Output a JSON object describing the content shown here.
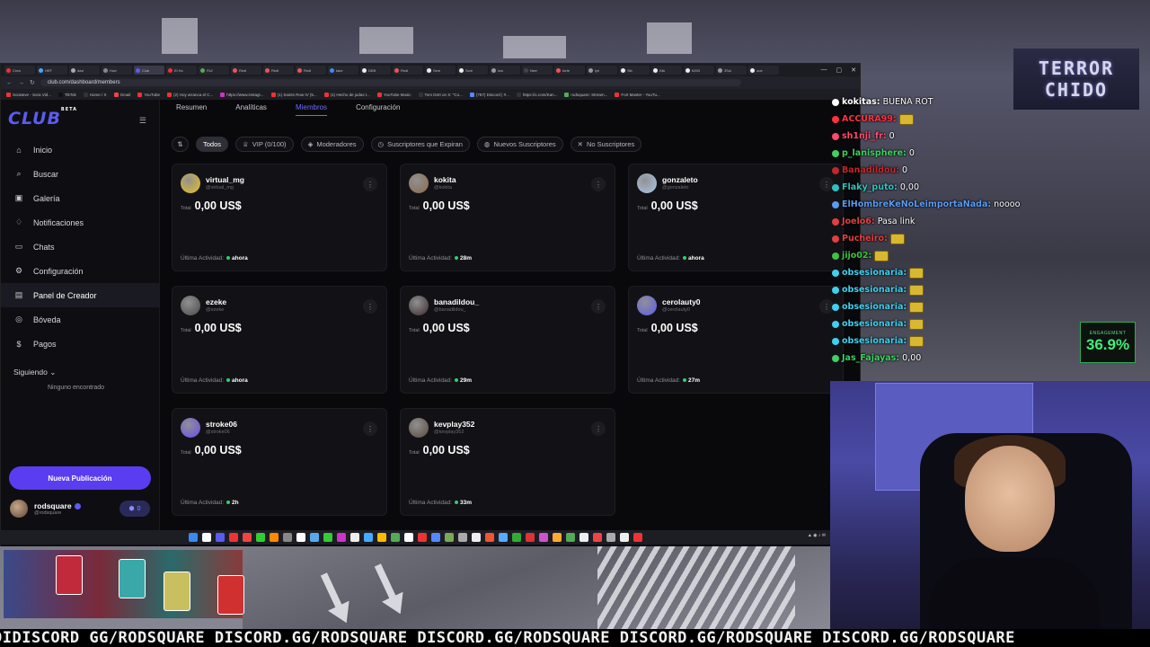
{
  "browser": {
    "url": "club.com/dashboard/members",
    "tabs": [
      "Crea",
      "HEF",
      "davi",
      "Hom",
      "Club",
      "El Ho",
      "Fk2",
      "Redi",
      "Redi",
      "Redi",
      "take",
      "DEB",
      "Redi",
      "Sem",
      "Scre",
      "low",
      "Nem",
      "forte",
      "lyri",
      "Sib",
      "Kiki",
      "6393",
      "3Sol",
      "ooe"
    ],
    "bookmarks": [
      "Sorateve - Sora Vid...",
      "TikTok",
      "Home / X",
      "Gmail",
      "YouTube",
      "(2) Hoy arranca el C...",
      "https://www.instagr...",
      "(1) Saints Row IV (5...",
      "(1) Hecho de judas t...",
      "YouTube Music",
      "Tom Dört on X: \"Co...",
      "(787) Discord | #...",
      "https://x.com/Kan...",
      "rodsquare: Stream...",
      "Fort Master - YouTu..."
    ]
  },
  "sidebar": {
    "logo": "CLUB",
    "logo_sup": "BETA",
    "items": [
      {
        "label": "Inicio",
        "icon": "home-icon"
      },
      {
        "label": "Buscar",
        "icon": "search-icon"
      },
      {
        "label": "Galería",
        "icon": "gallery-icon"
      },
      {
        "label": "Notificaciones",
        "icon": "bell-icon"
      },
      {
        "label": "Chats",
        "icon": "chat-icon"
      },
      {
        "label": "Configuración",
        "icon": "gear-icon"
      },
      {
        "label": "Panel de Creador",
        "icon": "dashboard-icon"
      },
      {
        "label": "Bóveda",
        "icon": "vault-icon"
      },
      {
        "label": "Pagos",
        "icon": "dollar-icon"
      }
    ],
    "active_index": 6,
    "following_label": "Siguiendo",
    "following_empty": "Ninguno encontrado",
    "new_post": "Nueva Publicación",
    "profile": {
      "name": "rodsquare",
      "handle": "@rodsquare",
      "badge": "0"
    }
  },
  "main": {
    "tabs": [
      "Resumen",
      "Analíticas",
      "Miembros",
      "Configuración"
    ],
    "active_tab": 2,
    "filters": [
      "Todos",
      "VIP (0/100)",
      "Moderadores",
      "Suscriptores que Expiran",
      "Nuevos Suscriptores",
      "No Suscriptores"
    ],
    "total_label": "Total",
    "activity_label": "Última Actividad:",
    "members": [
      {
        "name": "virtual_mg",
        "handle": "@virtual_mg",
        "total": "0,00 US$",
        "activity": "ahora",
        "color": "#e8c020"
      },
      {
        "name": "kokita",
        "handle": "@kokita",
        "total": "0,00 US$",
        "activity": "28m",
        "color": "#8a6a4a"
      },
      {
        "name": "gonzaleto",
        "handle": "@gonzaleto",
        "total": "0,00 US$",
        "activity": "ahora",
        "color": "#a8c8e8"
      },
      {
        "name": "ezeke",
        "handle": "@ezeke",
        "total": "0,00 US$",
        "activity": "ahora",
        "color": "#4a4a4a"
      },
      {
        "name": "banadildou_",
        "handle": "@banadildou_",
        "total": "0,00 US$",
        "activity": "29m",
        "color": "#3a2a2a"
      },
      {
        "name": "cerolauty0",
        "handle": "@cerolauty0",
        "total": "0,00 US$",
        "activity": "27m",
        "color": "#5a5cf0"
      },
      {
        "name": "stroke06",
        "handle": "@stroke06",
        "total": "0,00 US$",
        "activity": "2h",
        "color": "#6a4af0"
      },
      {
        "name": "kevplay352",
        "handle": "@kevplay352",
        "total": "0,00 US$",
        "activity": "33m",
        "color": "#5a4a3a"
      }
    ]
  },
  "chat": [
    {
      "user": "kokitas",
      "msg": "BUENA ROT",
      "color": "#ffffff",
      "emote": false
    },
    {
      "user": "ACCURA99",
      "msg": "",
      "color": "#ff3040",
      "emote": true
    },
    {
      "user": "sh1nji_fr",
      "msg": "0",
      "color": "#ff4a6a",
      "emote": false
    },
    {
      "user": "p_lanisphere",
      "msg": "0",
      "color": "#3fd060",
      "emote": false
    },
    {
      "user": "Banadildou",
      "msg": "0",
      "color": "#c0282a",
      "emote": false
    },
    {
      "user": "Flaky_puto",
      "msg": "0,00",
      "color": "#30c0c0",
      "emote": false
    },
    {
      "user": "ElHombreKeNoLeimportaNada",
      "msg": "noooo",
      "color": "#5a9af0",
      "emote": false
    },
    {
      "user": "Joelo6",
      "msg": "Pasa link",
      "color": "#e04040",
      "emote": false
    },
    {
      "user": "Pucheiro",
      "msg": "",
      "color": "#e04040",
      "emote": true
    },
    {
      "user": "jijo02",
      "msg": "",
      "color": "#40c040",
      "emote": true
    },
    {
      "user": "obsesionaria",
      "msg": "",
      "color": "#3fd0f0",
      "emote": true
    },
    {
      "user": "obsesionaria",
      "msg": "",
      "color": "#3fd0f0",
      "emote": true
    },
    {
      "user": "obsesionaria",
      "msg": "",
      "color": "#3fd0f0",
      "emote": true
    },
    {
      "user": "obsesionaria",
      "msg": "",
      "color": "#3fd0f0",
      "emote": true
    },
    {
      "user": "obsesionaria",
      "msg": "",
      "color": "#3fd0f0",
      "emote": true
    },
    {
      "user": "Jas_Fajayas",
      "msg": "0,00",
      "color": "#3fd060",
      "emote": false
    }
  ],
  "overlay": {
    "logo_line1": "TERROR",
    "logo_line2": "CHIDO",
    "engagement_label": "ENGAGEMENT",
    "engagement_value": "36.9%",
    "ticker": "DIDISCORD GG/RODSQUARE DISCORD.GG/RODSQUARE DISCORD.GG/RODSQUARE DISCORD.GG/RODSQUARE DISCORD.GG/RODSQUARE"
  }
}
